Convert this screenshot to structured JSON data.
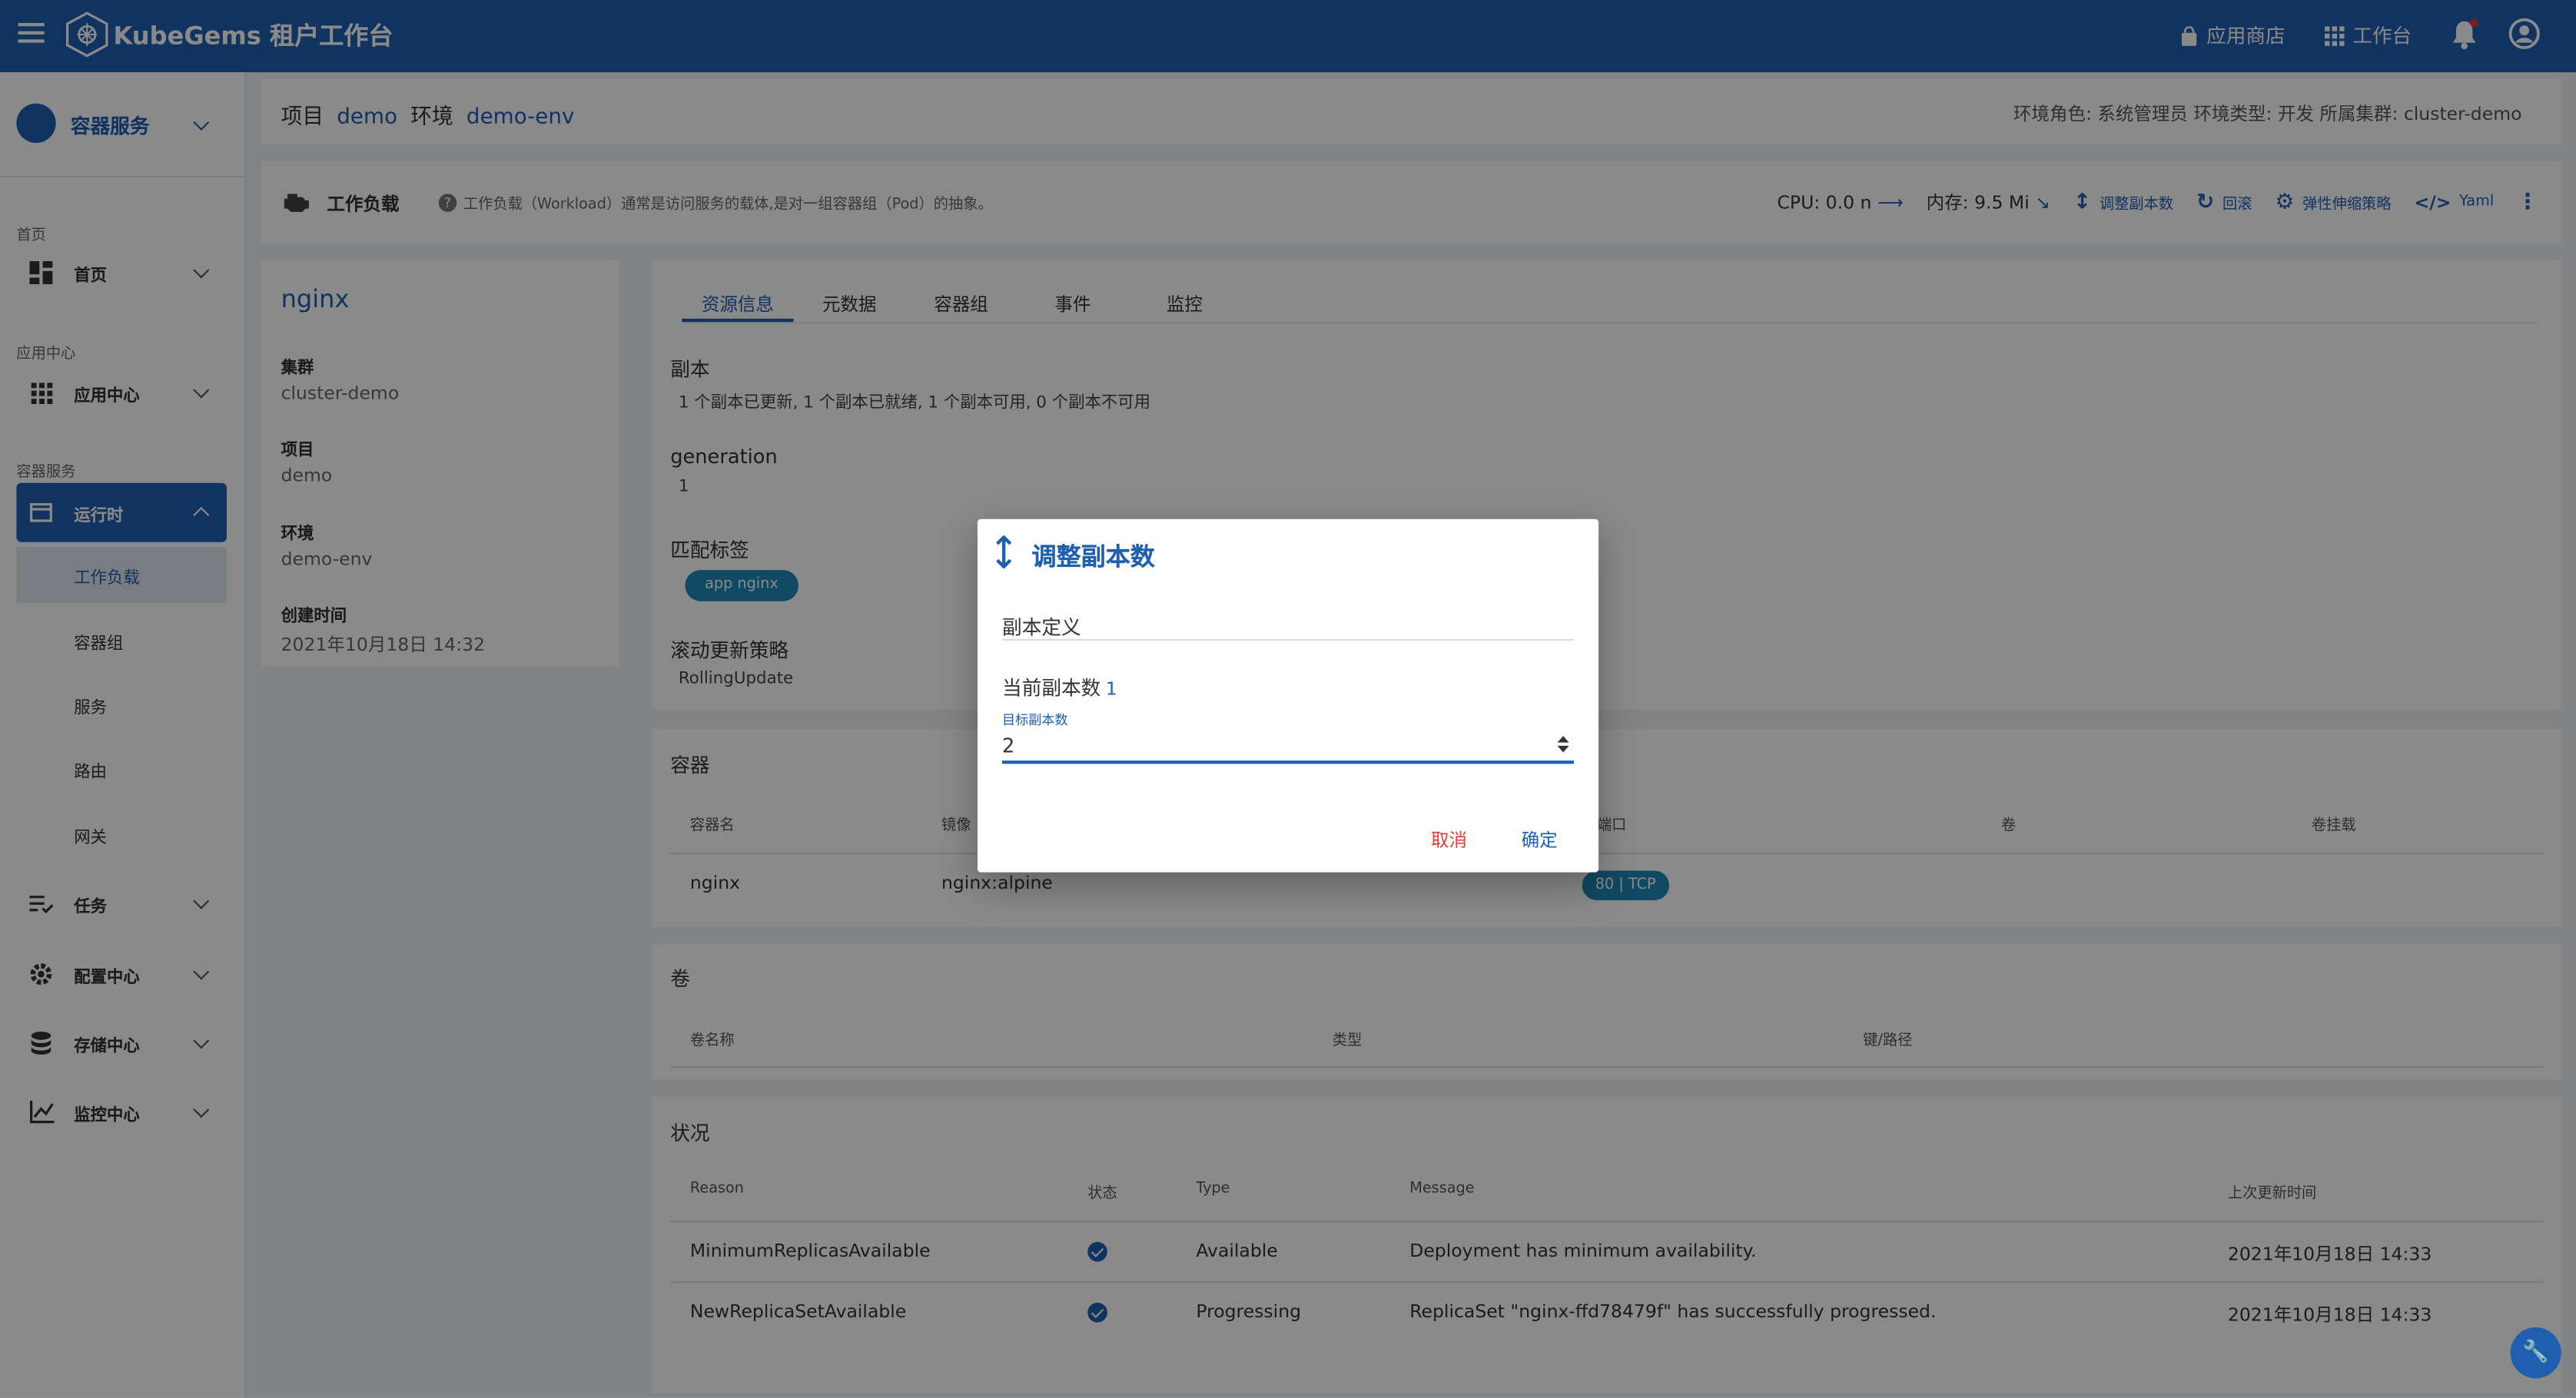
{
  "topbar": {
    "brand": "KubeGems 租户工作台",
    "app_store": "应用商店",
    "workbench": "工作台"
  },
  "sidebar": {
    "header": "容器服务",
    "group_home": "首页",
    "item_home": "首页",
    "group_app": "应用中心",
    "item_app": "应用中心",
    "group_container": "容器服务",
    "item_runtime": "运行时",
    "sub_workload": "工作负载",
    "sub_pod": "容器组",
    "sub_service": "服务",
    "sub_route": "路由",
    "sub_gateway": "网关",
    "item_task": "任务",
    "item_config": "配置中心",
    "item_storage": "存储中心",
    "item_monitor": "监控中心"
  },
  "breadcrumb": {
    "project_label": "项目",
    "project": "demo",
    "env_label": "环境",
    "env": "demo-env",
    "right": "环境角色: 系统管理员   环境类型: 开发   所属集群: cluster-demo"
  },
  "workload_bar": {
    "title": "工作负载",
    "desc": "工作负载（Workload）通常是访问服务的载体,是对一组容器组（Pod）的抽象。",
    "cpu": "CPU: 0.0 n",
    "mem": "内存: 9.5 Mi",
    "scale": "调整副本数",
    "rollback": "回滚",
    "hpa": "弹性伸缩策略",
    "yaml": "Yaml"
  },
  "info": {
    "name": "nginx",
    "cluster_label": "集群",
    "cluster": "cluster-demo",
    "project_label": "项目",
    "project": "demo",
    "env_label": "环境",
    "env": "demo-env",
    "created_label": "创建时间",
    "created": "2021年10月18日 14:32"
  },
  "detail": {
    "tabs": [
      "资源信息",
      "元数据",
      "容器组",
      "事件",
      "监控"
    ],
    "replica_label": "副本",
    "replica": "1 个副本已更新, 1 个副本已就绪, 1 个副本可用, 0 个副本不可用",
    "gen_label": "generation",
    "gen": "1",
    "labels_label": "匹配标签",
    "label_chip": "app nginx",
    "strategy_label": "滚动更新策略",
    "strategy": "RollingUpdate"
  },
  "containers": {
    "title": "容器",
    "headers": [
      "容器名",
      "镜像",
      "端口",
      "卷",
      "卷挂载"
    ],
    "row": {
      "name": "nginx",
      "image": "nginx:alpine",
      "port": "80 | TCP"
    }
  },
  "volumes": {
    "title": "卷",
    "headers": [
      "卷名称",
      "类型",
      "键/路径"
    ]
  },
  "status": {
    "title": "状况",
    "headers": [
      "Reason",
      "状态",
      "Type",
      "Message",
      "上次更新时间"
    ],
    "rows": [
      {
        "reason": "MinimumReplicasAvailable",
        "type": "Available",
        "message": "Deployment has minimum availability.",
        "time": "2021年10月18日 14:33"
      },
      {
        "reason": "NewReplicaSetAvailable",
        "type": "Progressing",
        "message": "ReplicaSet \"nginx-ffd78479f\" has successfully progressed.",
        "time": "2021年10月18日 14:33"
      }
    ]
  },
  "dialog": {
    "title": "调整副本数",
    "section": "副本定义",
    "current_label": "当前副本数",
    "current": "1",
    "target_label": "目标副本数",
    "target": "2",
    "cancel": "取消",
    "confirm": "确定"
  },
  "colors": {
    "primary": "#1e5fb0",
    "danger": "#e53935",
    "chip": "#1e88b8"
  }
}
